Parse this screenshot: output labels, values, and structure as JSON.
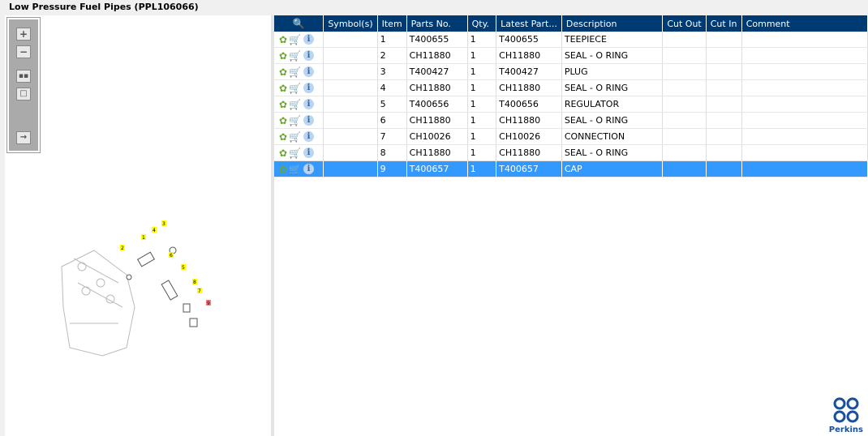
{
  "title": "Low Pressure Fuel Pipes (PPL106066)",
  "toolbar": {
    "icons": [
      "zoom-in",
      "zoom-out",
      "fit-all",
      "actual-size",
      "export"
    ]
  },
  "table": {
    "headers": [
      "",
      "Symbol(s)",
      "Item",
      "Parts No.",
      "Qty.",
      "Latest Part...",
      "Description",
      "Cut Out",
      "Cut In",
      "Comment"
    ],
    "rows": [
      {
        "symbols": "",
        "item": "1",
        "part": "T400655",
        "qty": "1",
        "latest": "T400655",
        "desc": "TEEPIECE",
        "cut_out": "",
        "cut_in": "",
        "comment": ""
      },
      {
        "symbols": "",
        "item": "2",
        "part": "CH11880",
        "qty": "1",
        "latest": "CH11880",
        "desc": "SEAL - O RING",
        "cut_out": "",
        "cut_in": "",
        "comment": ""
      },
      {
        "symbols": "",
        "item": "3",
        "part": "T400427",
        "qty": "1",
        "latest": "T400427",
        "desc": "PLUG",
        "cut_out": "",
        "cut_in": "",
        "comment": ""
      },
      {
        "symbols": "",
        "item": "4",
        "part": "CH11880",
        "qty": "1",
        "latest": "CH11880",
        "desc": "SEAL - O RING",
        "cut_out": "",
        "cut_in": "",
        "comment": ""
      },
      {
        "symbols": "",
        "item": "5",
        "part": "T400656",
        "qty": "1",
        "latest": "T400656",
        "desc": "REGULATOR",
        "cut_out": "",
        "cut_in": "",
        "comment": ""
      },
      {
        "symbols": "",
        "item": "6",
        "part": "CH11880",
        "qty": "1",
        "latest": "CH11880",
        "desc": "SEAL - O RING",
        "cut_out": "",
        "cut_in": "",
        "comment": ""
      },
      {
        "symbols": "",
        "item": "7",
        "part": "CH10026",
        "qty": "1",
        "latest": "CH10026",
        "desc": "CONNECTION",
        "cut_out": "",
        "cut_in": "",
        "comment": ""
      },
      {
        "symbols": "",
        "item": "8",
        "part": "CH11880",
        "qty": "1",
        "latest": "CH11880",
        "desc": "SEAL - O RING",
        "cut_out": "",
        "cut_in": "",
        "comment": ""
      },
      {
        "symbols": "",
        "item": "9",
        "part": "T400657",
        "qty": "1",
        "latest": "T400657",
        "desc": "CAP",
        "cut_out": "",
        "cut_in": "",
        "comment": ""
      }
    ],
    "selected_item": "9"
  },
  "diagram": {
    "callouts": [
      "1",
      "2",
      "3",
      "4",
      "5",
      "6",
      "7",
      "8",
      "9"
    ]
  },
  "logo": {
    "text": "Perkins"
  },
  "colors": {
    "header": "#003a73",
    "selected": "#3399ff",
    "callout": "#ffff00",
    "callout_selected": "#f08080"
  }
}
